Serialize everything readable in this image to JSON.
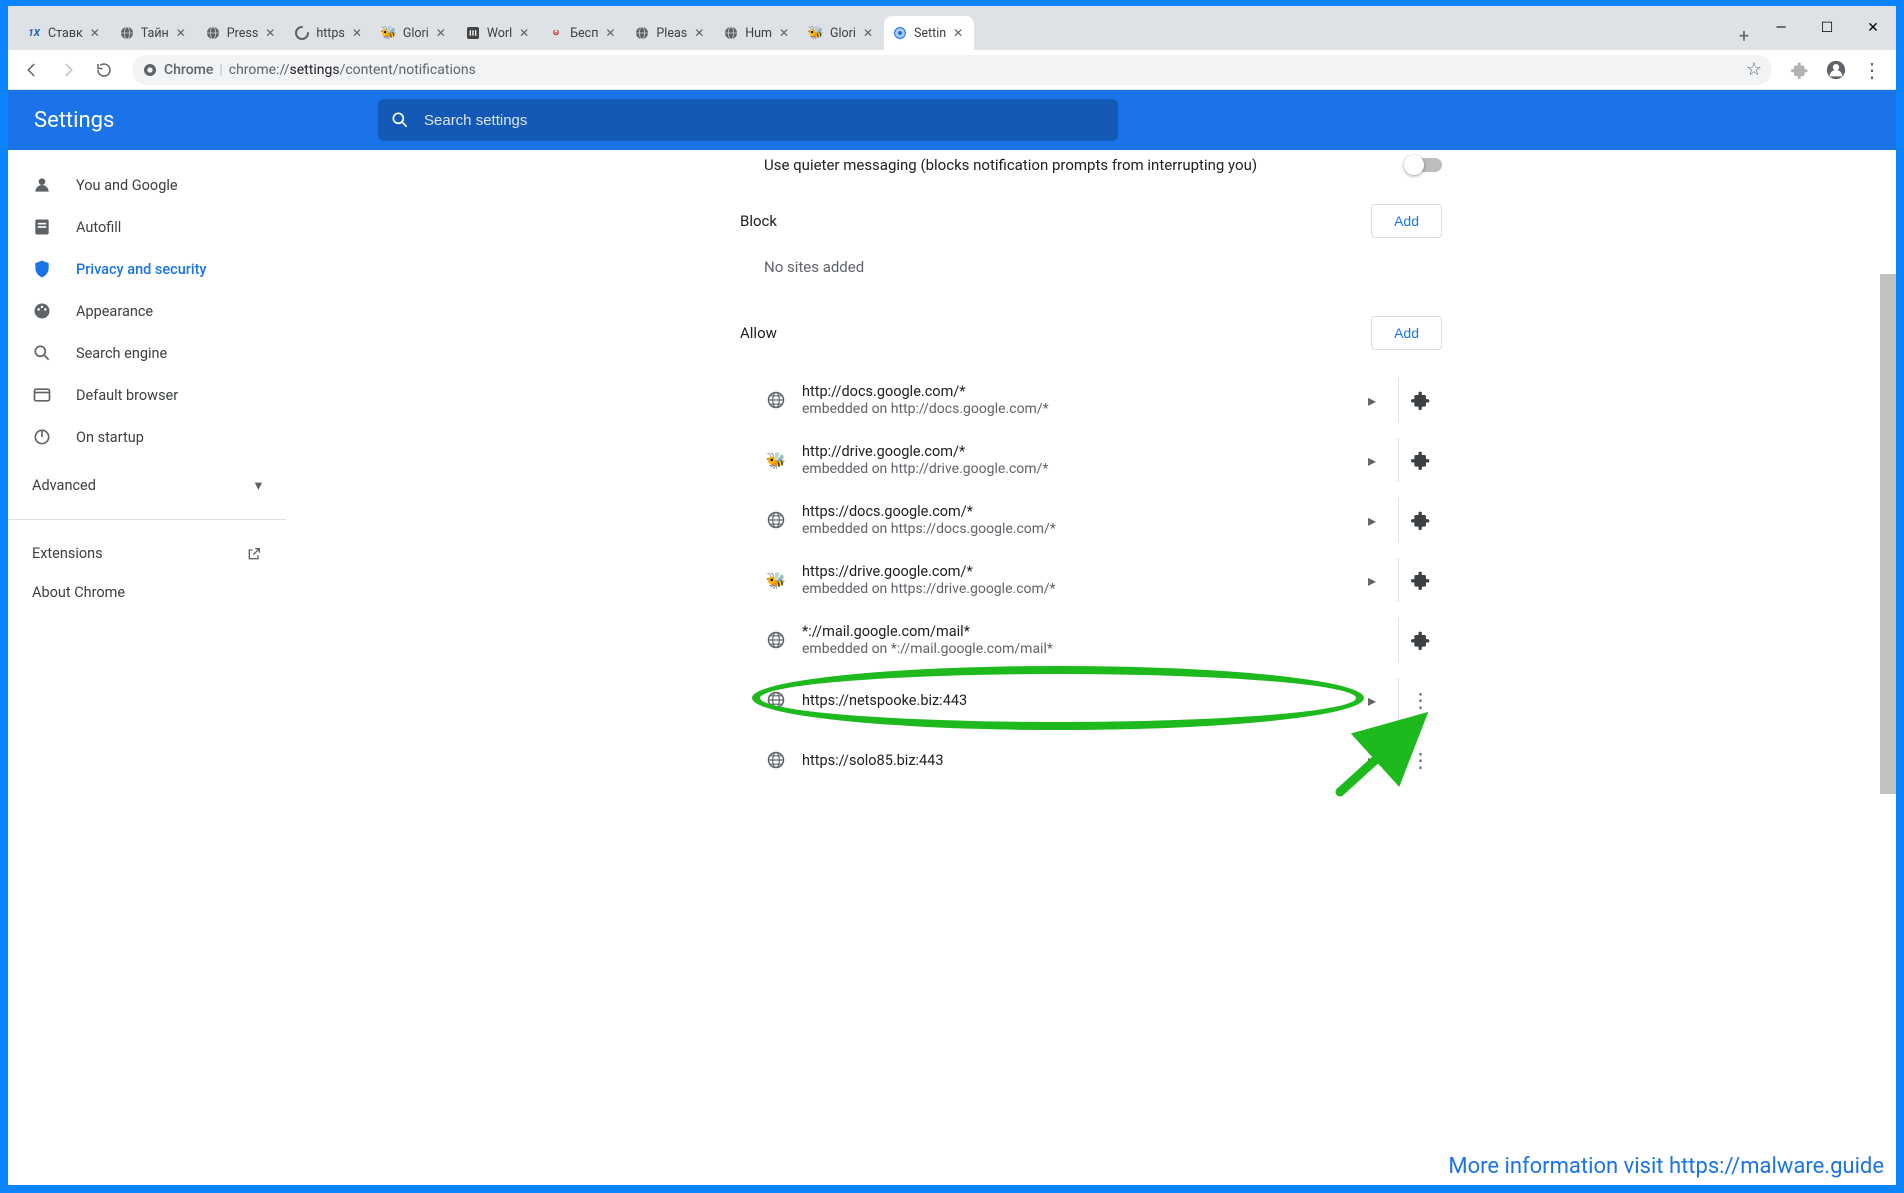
{
  "window": {
    "tabs": [
      {
        "label": "Ставк",
        "fav": "1x"
      },
      {
        "label": "Тайн",
        "fav": "globe"
      },
      {
        "label": "Press",
        "fav": "globe"
      },
      {
        "label": "https",
        "fav": "spin"
      },
      {
        "label": "Glori",
        "fav": "bee"
      },
      {
        "label": "Worl",
        "fav": "wot"
      },
      {
        "label": "Бесп",
        "fav": "link"
      },
      {
        "label": "Pleas",
        "fav": "globe"
      },
      {
        "label": "Hum",
        "fav": "globe"
      },
      {
        "label": "Glori",
        "fav": "bee"
      },
      {
        "label": "Settin",
        "fav": "gear",
        "active": true
      }
    ],
    "controls": {
      "minimize": "—",
      "maximize": "☐",
      "close": "✕"
    }
  },
  "omnibox": {
    "prefix": "Chrome",
    "url_main": "chrome://",
    "url_bold": "settings",
    "url_rest": "/content/notifications"
  },
  "header": {
    "brand": "Settings",
    "search_placeholder": "Search settings"
  },
  "sidebar": {
    "items": [
      {
        "label": "You and Google",
        "icon": "person"
      },
      {
        "label": "Autofill",
        "icon": "autofill"
      },
      {
        "label": "Privacy and security",
        "icon": "shield",
        "active": true
      },
      {
        "label": "Appearance",
        "icon": "palette"
      },
      {
        "label": "Search engine",
        "icon": "search"
      },
      {
        "label": "Default browser",
        "icon": "browser"
      },
      {
        "label": "On startup",
        "icon": "power"
      }
    ],
    "advanced_label": "Advanced",
    "extensions_label": "Extensions",
    "about_label": "About Chrome"
  },
  "content": {
    "quiet_row": "Use quieter messaging (blocks notification prompts from interrupting you)",
    "block": {
      "title": "Block",
      "add": "Add",
      "empty": "No sites added"
    },
    "allow": {
      "title": "Allow",
      "add": "Add",
      "sites": [
        {
          "url": "http://docs.google.com/*",
          "sub": "embedded on http://docs.google.com/*",
          "fav": "globe",
          "right": "ext"
        },
        {
          "url": "http://drive.google.com/*",
          "sub": "embedded on http://drive.google.com/*",
          "fav": "bee",
          "right": "ext"
        },
        {
          "url": "https://docs.google.com/*",
          "sub": "embedded on https://docs.google.com/*",
          "fav": "globe",
          "right": "ext"
        },
        {
          "url": "https://drive.google.com/*",
          "sub": "embedded on https://drive.google.com/*",
          "fav": "bee",
          "right": "ext"
        },
        {
          "url": "*://mail.google.com/mail*",
          "sub": "embedded on *://mail.google.com/mail*",
          "fav": "globe",
          "right": "ext_noarrow"
        },
        {
          "url": "https://netspooke.biz:443",
          "sub": "",
          "fav": "globe",
          "right": "more",
          "highlight": true
        },
        {
          "url": "https://solo85.biz:443",
          "sub": "",
          "fav": "globe",
          "right": "more"
        }
      ]
    }
  },
  "footer": "More information visit https://malware.guide"
}
